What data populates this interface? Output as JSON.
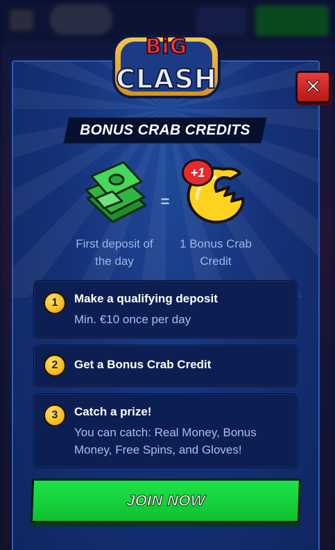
{
  "logo": {
    "line1": "BiG",
    "line2": "CLASH"
  },
  "modal": {
    "title": "BONUS CRAB CREDITS",
    "close_label": "✕",
    "equation": {
      "left_caption": "First deposit of the day",
      "equals": "=",
      "right_caption": "1 Bonus Crab Credit",
      "badge": "+1"
    },
    "steps": [
      {
        "number": "1",
        "title": "Make a qualifying deposit",
        "description": "Min. €10 once per day"
      },
      {
        "number": "2",
        "title": "Get a Bonus Crab Credit",
        "description": ""
      },
      {
        "number": "3",
        "title": "Catch a prize!",
        "description": "You can catch: Real Money, Bonus Money, Free Spins, and Gloves!"
      }
    ],
    "cta_label": "JOIN NOW"
  },
  "colors": {
    "accent_green": "#13c935",
    "close_red": "#d42020",
    "modal_blue": "#15327a",
    "step_panel": "#0d1f52",
    "badge_gold": "#f3b514"
  }
}
